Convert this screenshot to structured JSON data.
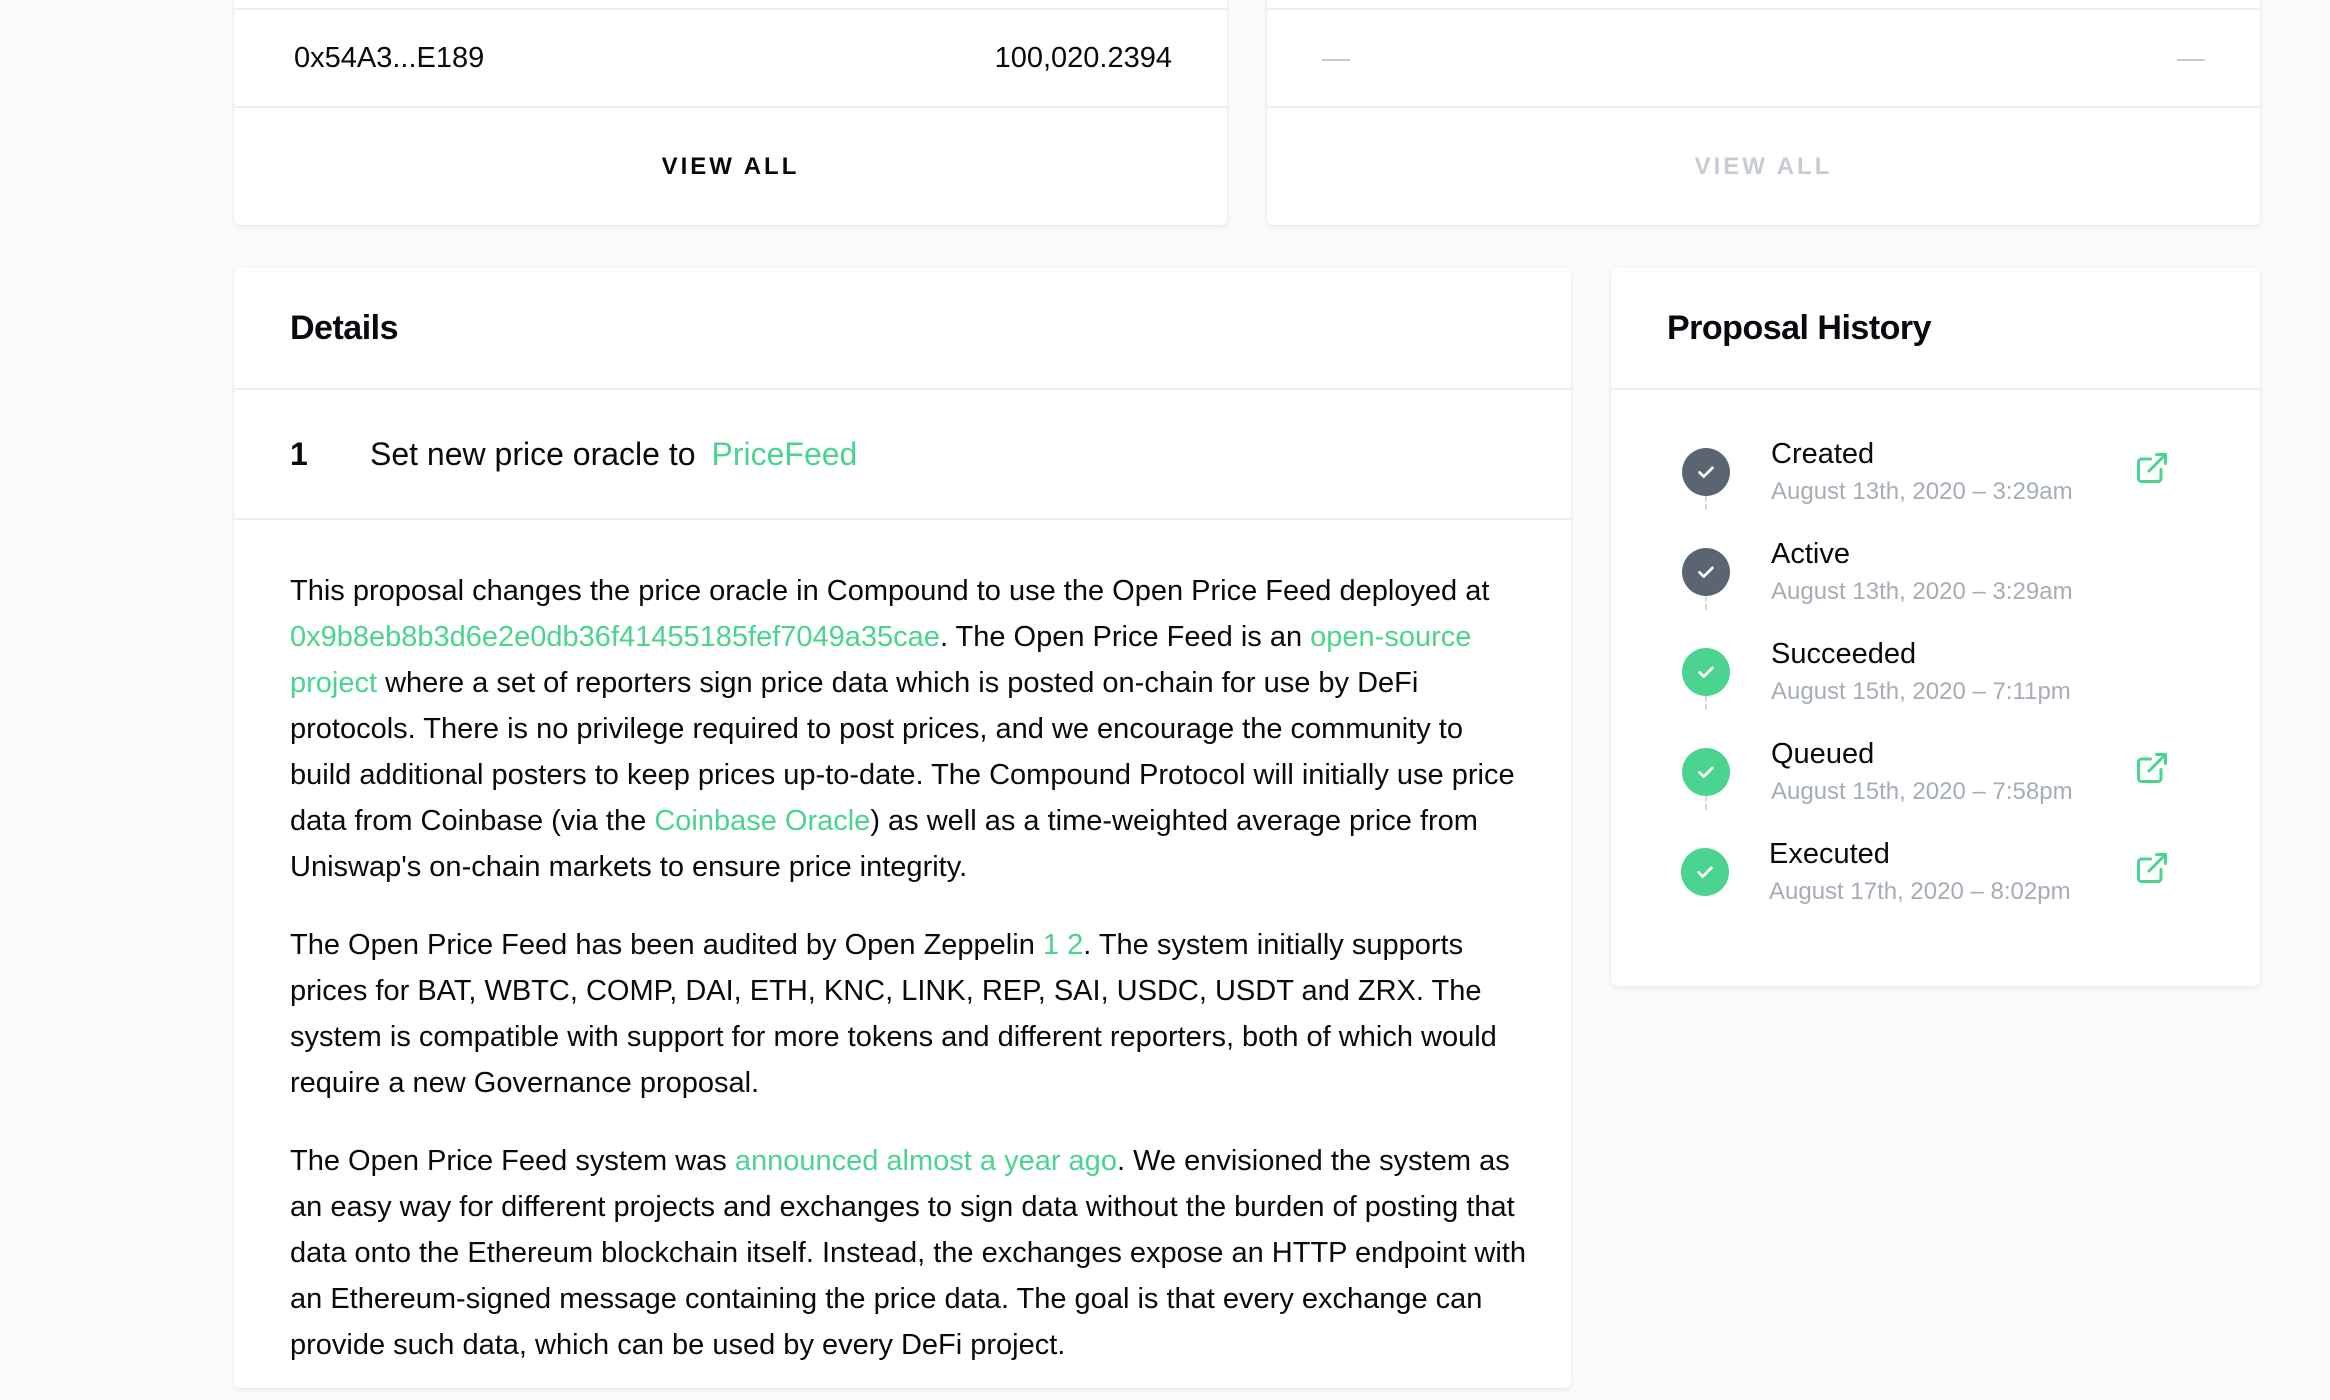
{
  "voters_left": {
    "address": "0x54A3...E189",
    "votes": "100,020.2394",
    "view_all_label": "VIEW ALL"
  },
  "voters_right": {
    "address": "—",
    "votes": "—",
    "view_all_label": "VIEW ALL"
  },
  "details": {
    "title": "Details",
    "action": {
      "number": "1",
      "text": "Set new price oracle to",
      "target": "PriceFeed"
    },
    "paragraph1": {
      "t1": "This proposal changes the price oracle in Compound to use the Open Price Feed deployed at ",
      "address_link": "0x9b8eb8b3d6e2e0db36f41455185fef7049a35cae",
      "t2": ". The Open Price Feed is an ",
      "open_source_link": "open-source project",
      "t3": " where a set of reporters sign price data which is posted on-chain for use by DeFi protocols. There is no privilege required to post prices, and we encourage the community to build additional posters to keep prices up-to-date. The Compound Protocol will initially use price data from Coinbase (via the ",
      "coinbase_link": "Coinbase Oracle",
      "t4": ") as well as a time-weighted average price from Uniswap's on-chain markets to ensure price integrity."
    },
    "paragraph2": {
      "t1": "The Open Price Feed has been audited by Open Zeppelin ",
      "audit_link_1": "1",
      "audit_link_2": "2",
      "t2": ". The system initially supports prices for BAT, WBTC, COMP, DAI, ETH, KNC, LINK, REP, SAI, USDC, USDT and ZRX. The system is compatible with support for more tokens and different reporters, both of which would require a new Governance proposal."
    },
    "paragraph3": {
      "t1": "The Open Price Feed system was ",
      "announced_link": "announced almost a year ago",
      "t2": ". We envisioned the system as an easy way for different projects and exchanges to sign data without the burden of posting that data onto the Ethereum blockchain itself. Instead, the exchanges expose an HTTP endpoint with an Ethereum-signed message containing the price data. The goal is that every exchange can provide such data, which can be used by every DeFi project."
    }
  },
  "history": {
    "title": "Proposal History",
    "steps": [
      {
        "title": "Created",
        "date": "August 13th, 2020 – 3:29am",
        "status_color": "#5b6572",
        "has_link": true
      },
      {
        "title": "Active",
        "date": "August 13th, 2020 – 3:29am",
        "status_color": "#5b6572",
        "has_link": false
      },
      {
        "title": "Succeeded",
        "date": "August 15th, 2020 – 7:11pm",
        "status_color": "#4ad48f",
        "has_link": false
      },
      {
        "title": "Queued",
        "date": "August 15th, 2020 – 7:58pm",
        "status_color": "#4ad48f",
        "has_link": true
      },
      {
        "title": "Executed",
        "date": "August 17th, 2020 – 8:02pm",
        "status_color": "#4ad48f",
        "has_link": true
      }
    ]
  },
  "colors": {
    "accent_green": "#4ad48f",
    "muted_gray": "#5b6572",
    "text_dark": "#070a0e",
    "text_muted": "#a5adb7"
  }
}
